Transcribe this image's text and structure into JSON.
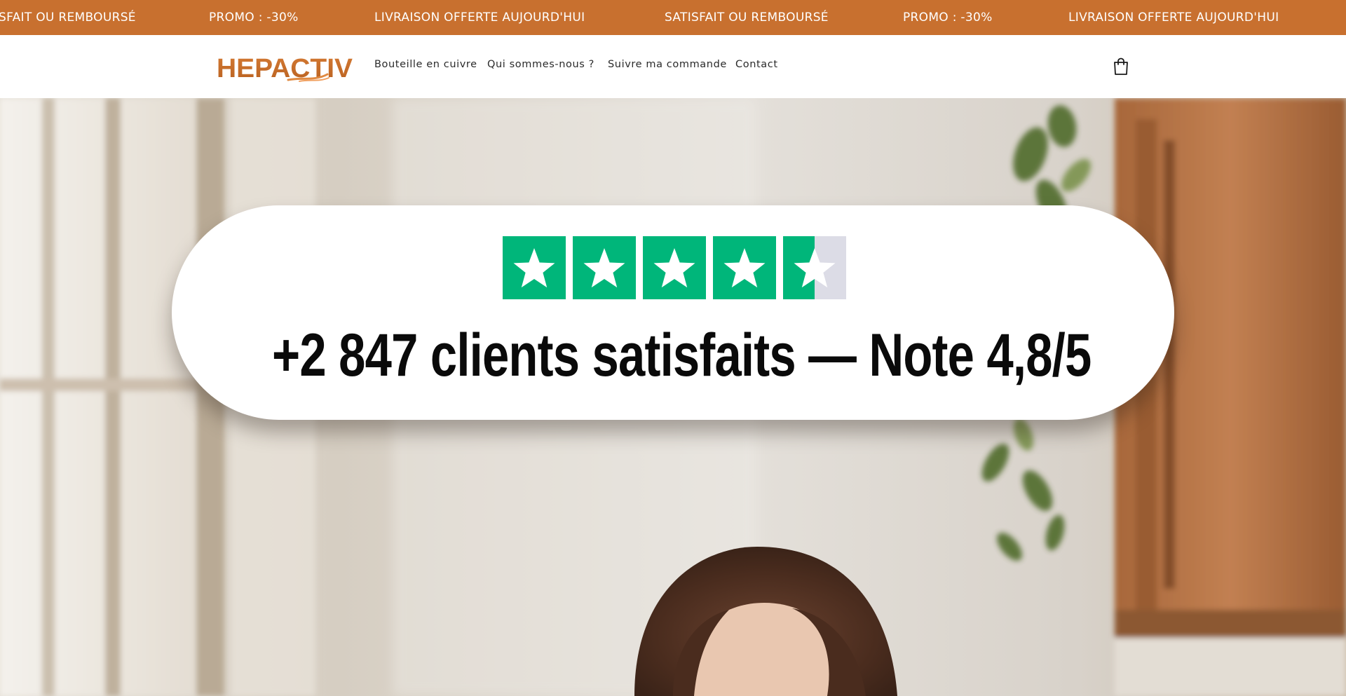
{
  "announcement": {
    "messages": [
      "SFAIT OU REMBOURSÉ",
      "PROMO : -30%",
      "LIVRAISON OFFERTE AUJOURD'HUI",
      "SATISFAIT OU REMBOURSÉ",
      "PROMO : -30%",
      "LIVRAISON OFFERTE AUJOURD'HUI"
    ]
  },
  "header": {
    "logo_text": "HEPACTIV",
    "nav": [
      "Bouteille en cuivre",
      "Qui sommes-nous ?",
      "Suivre ma commande",
      "Contact"
    ],
    "cart_icon": "shopping-bag-icon"
  },
  "hero": {
    "rating_stars": 4.5,
    "rating_max": 5,
    "headline": "+2 847 clients satisfaits — Note 4,8/5"
  },
  "colors": {
    "accent": "#c8702f",
    "star_green": "#00b67a",
    "star_empty": "#dcdce6",
    "text_dark": "#0a0a0a"
  }
}
